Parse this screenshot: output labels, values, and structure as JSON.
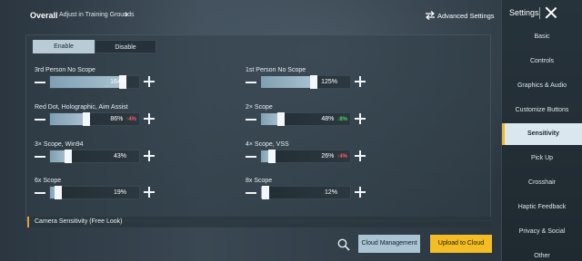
{
  "topbar": {
    "title": "Overall",
    "subtitle": "Adjust in Training Grounds",
    "chevron": "›",
    "advanced_label": "Advanced Settings",
    "advanced_icon": "swap-arrows-icon"
  },
  "mode_toggle": {
    "enable": "Enable",
    "disable": "Disable",
    "selected": "Enable"
  },
  "settings": [
    {
      "label": "3rd Person No Scope",
      "value": "164%",
      "level": 0.8,
      "badge": "",
      "badge_color": ""
    },
    {
      "label": "1st Person No Scope",
      "value": "125%",
      "level": 0.58,
      "badge": "",
      "badge_color": ""
    },
    {
      "label": "Red Dot, Holographic, Aim Assist",
      "value": "86%",
      "level": 0.4,
      "badge": "↑4%",
      "badge_color": "#ff5b5b"
    },
    {
      "label": "2× Scope",
      "value": "48%",
      "level": 0.22,
      "badge": "↓8%",
      "badge_color": "#48d55c"
    },
    {
      "label": "3× Scope, Win94",
      "value": "43%",
      "level": 0.2,
      "badge": "",
      "badge_color": ""
    },
    {
      "label": "4× Scope, VSS",
      "value": "26%",
      "level": 0.12,
      "badge": "↑4%",
      "badge_color": "#ff5b5b"
    },
    {
      "label": "6x Scope",
      "value": "19%",
      "level": 0.09,
      "badge": "",
      "badge_color": ""
    },
    {
      "label": "8x Scope",
      "value": "12%",
      "level": 0.05,
      "badge": "",
      "badge_color": ""
    }
  ],
  "camera_section": {
    "label": "Camera Sensitivity (Free Look)"
  },
  "footer": {
    "search_icon": "search-icon",
    "cloud_label": "Cloud Management",
    "upload_label": "Upload to Cloud"
  },
  "sidebar": {
    "title": "Settings",
    "items": [
      {
        "label": "Basic",
        "active": false
      },
      {
        "label": "Controls",
        "active": false
      },
      {
        "label": "Graphics & Audio",
        "active": false
      },
      {
        "label": "Customize Buttons",
        "active": false
      },
      {
        "label": "Sensitivity",
        "active": true
      },
      {
        "label": "Pick Up",
        "active": false
      },
      {
        "label": "Crosshair",
        "active": false
      },
      {
        "label": "Haptic Feedback",
        "active": false
      },
      {
        "label": "Privacy & Social",
        "active": false
      },
      {
        "label": "Other",
        "active": false
      }
    ]
  },
  "colors": {
    "accent_yellow": "#f3bd23",
    "badge_up": "#ff5b5b",
    "badge_down": "#48d55c",
    "slider_fill": "#a9c2d0"
  }
}
